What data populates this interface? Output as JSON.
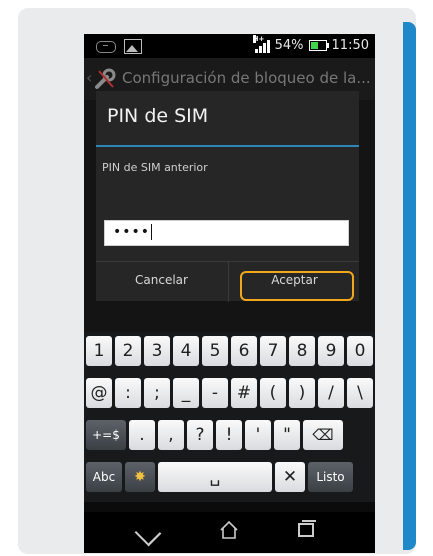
{
  "status_bar": {
    "network_type": "H+",
    "battery_percent": "54%",
    "time": "11:50",
    "icons": [
      "voicemail-icon",
      "image-icon",
      "signal-icon",
      "battery-icon"
    ]
  },
  "action_bar": {
    "title": "Configuración de bloqueo de la...",
    "icons": [
      "back-icon",
      "wrench-icon"
    ]
  },
  "dialog": {
    "title": "PIN de SIM",
    "field_label": "PIN de SIM anterior",
    "field_value": "••••",
    "cancel_label": "Cancelar",
    "accept_label": "Aceptar",
    "accent_color": "#2f86b9",
    "highlight_color": "#f0a81c"
  },
  "keyboard": {
    "row1": [
      "1",
      "2",
      "3",
      "4",
      "5",
      "6",
      "7",
      "8",
      "9",
      "0"
    ],
    "row2": [
      "@",
      ":",
      ";",
      "_",
      "-",
      "#",
      "(",
      ")",
      "/",
      "\\"
    ],
    "row3": [
      "+=$",
      ".",
      ",",
      "?",
      "!",
      "'",
      "\"",
      "⌫"
    ],
    "row4": [
      "Abc",
      "✸",
      "␣",
      "✕",
      "Listo"
    ]
  },
  "nav_bar": {
    "icons": [
      "back-icon",
      "home-icon",
      "recent-apps-icon"
    ]
  }
}
